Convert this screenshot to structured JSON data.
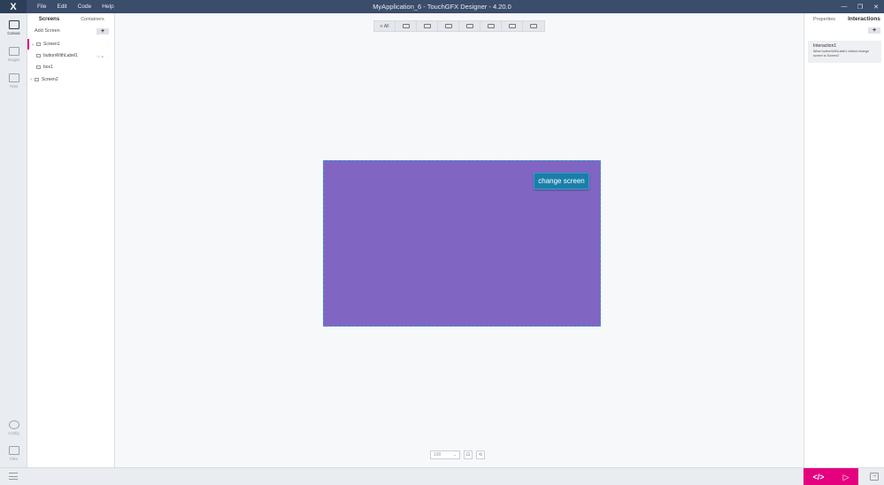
{
  "titlebar": {
    "logo": "X",
    "menu": [
      "File",
      "Edit",
      "Code",
      "Help"
    ],
    "title": "MyApplication_6 - TouchGFX Designer - 4.20.0",
    "controls": [
      "—",
      "❐",
      "✕"
    ]
  },
  "rail": {
    "canvas": "Canvas",
    "images": "Images",
    "texts": "Texts",
    "config": "Config",
    "files": "Files"
  },
  "screens_panel": {
    "tabs": [
      "Screens",
      "Containers"
    ],
    "add_screen": "Add Screen",
    "add_symbol": "+",
    "tree": [
      {
        "label": "Screen1"
      },
      {
        "label": "buttonWithLabel1"
      },
      {
        "label": "box1"
      },
      {
        "label": "Screen2"
      }
    ]
  },
  "toolbar": {
    "all_label": "All"
  },
  "canvas": {
    "screen_color": "#8066c2",
    "button_label": "change screen",
    "zoom": "100"
  },
  "right_panel": {
    "tabs": [
      "Properties",
      "Interactions"
    ],
    "add_symbol": "+",
    "interaction": {
      "title": "Interaction1",
      "description": "When buttonWithLabel1 clicked change screen to Screen2"
    }
  },
  "bottombar": {
    "code_symbol": "</>",
    "run_symbol": "▷",
    "accent": "#e5007e"
  }
}
